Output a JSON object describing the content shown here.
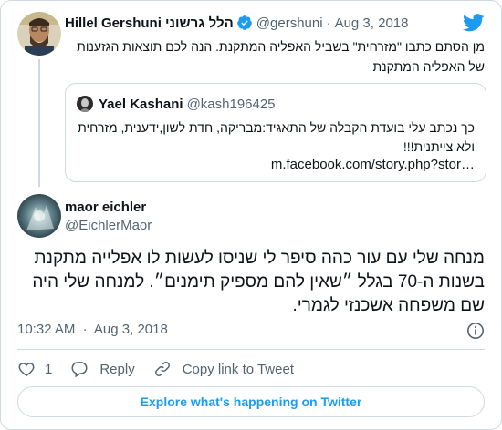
{
  "parent_tweet": {
    "name": "Hillel Gershuni הלל גרשוני",
    "handle": "@gershuni",
    "separator": "·",
    "date": "Aug 3, 2018",
    "text": "מן הסתם כתבו \"מזרחית\" בשביל האפליה המתקנת. הנה לכם תוצאות הגזענות של האפליה המתקנת",
    "verified": true,
    "avatar_icon": "user-photo",
    "brand_icon": "twitter-bird-icon",
    "brand_color": "#1d9bf0"
  },
  "quoted_tweet": {
    "name": "Yael Kashani",
    "handle": "@kash196425",
    "text": "כך נכתב עלי בועדת הקבלה של התאגיד:מבריקה, חדת לשון,ידענית, מזרחית ולא צייתנית!!!",
    "link": "m.facebook.com/story.php?stor…"
  },
  "main_tweet": {
    "name": "maor eichler",
    "handle": "@EichlerMaor",
    "text": "מנחה שלי עם עור כהה סיפר לי שניסו לעשות לו אפלייה מתקנת בשנות ה-70 בגלל ״שאין להם מספיק תימנים״. למנחה שלי היה שם משפחה אשכנזי לגמרי.",
    "time": "10:32 AM",
    "separator": "·",
    "date": "Aug 3, 2018"
  },
  "actions": {
    "like_count": "1",
    "reply_label": "Reply",
    "copy_link_label": "Copy link to Tweet"
  },
  "explore_label": "Explore what's happening on Twitter",
  "colors": {
    "text": "#0f1419",
    "secondary": "#536471",
    "border": "#cfd9de",
    "accent": "#1d9bf0"
  }
}
